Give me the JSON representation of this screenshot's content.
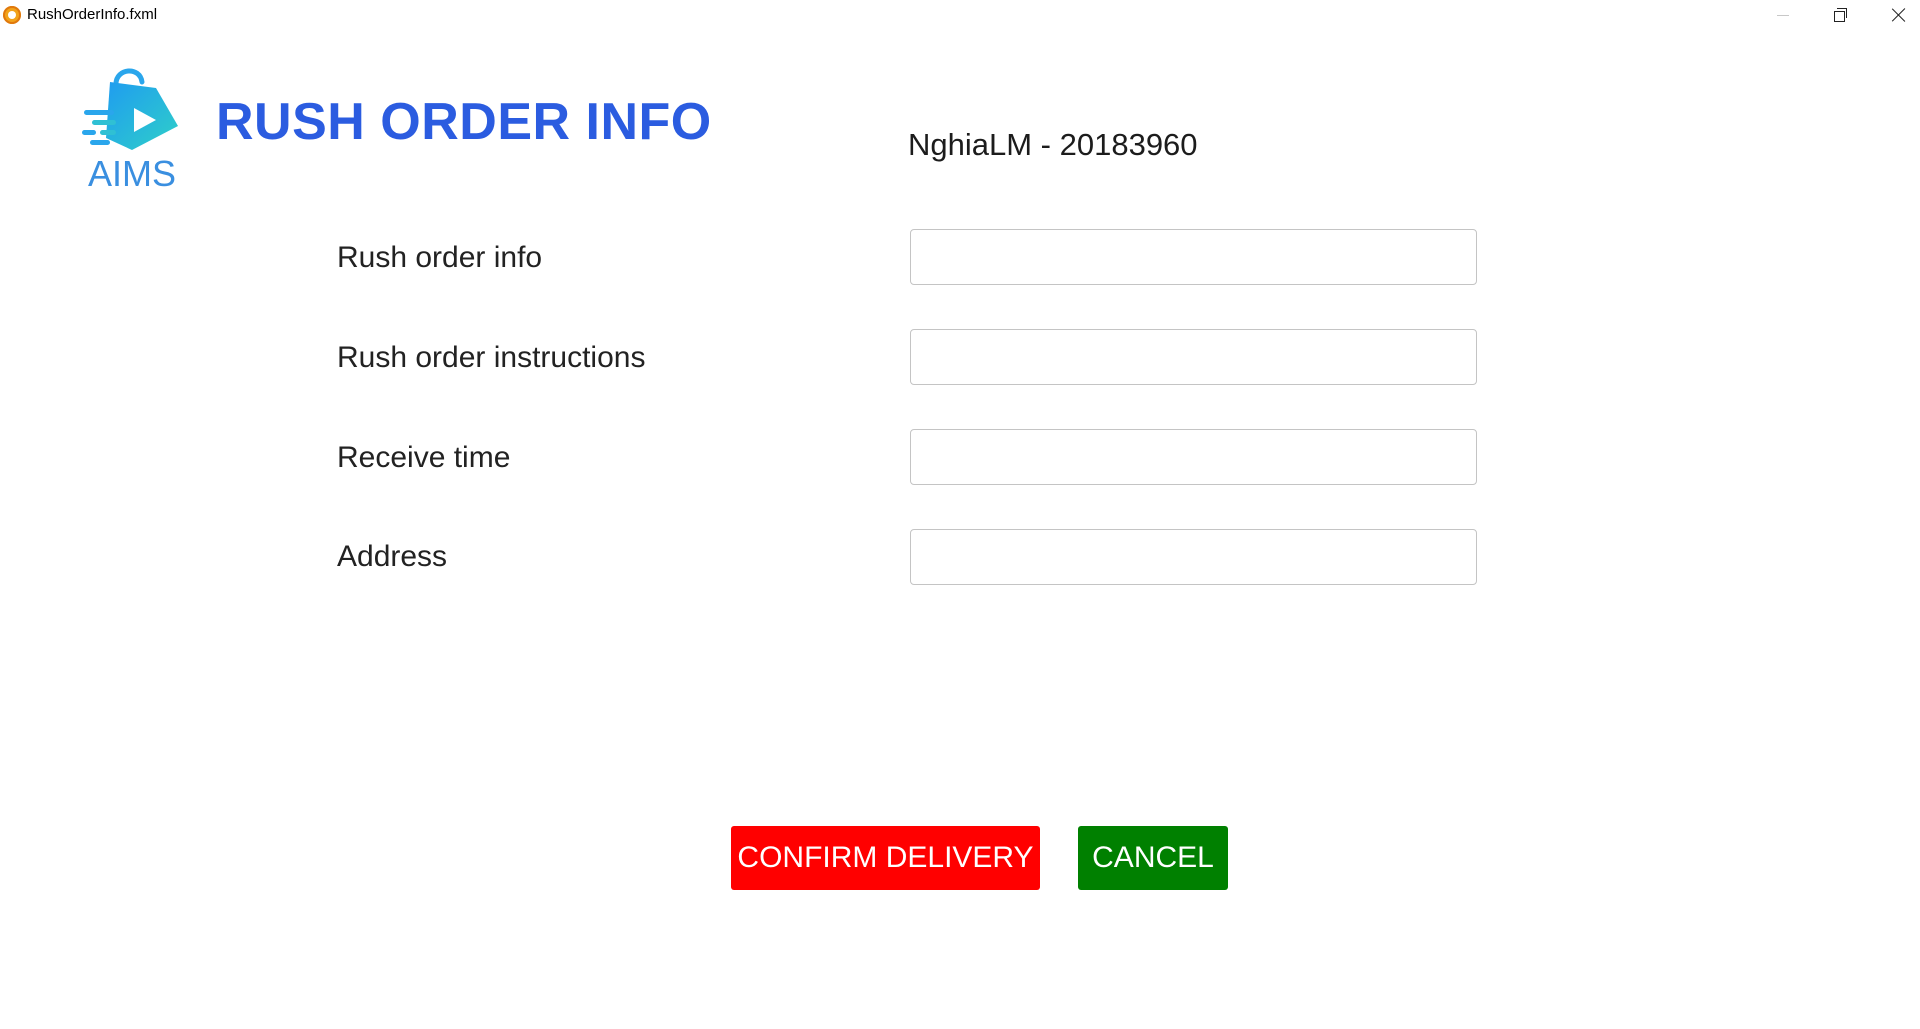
{
  "window": {
    "title": "RushOrderInfo.fxml"
  },
  "header": {
    "logo_text": "AIMS",
    "title": "RUSH ORDER INFO",
    "student_info": "NghiaLM - 20183960"
  },
  "form": {
    "fields": [
      {
        "label": "Rush order info",
        "value": "",
        "placeholder": ""
      },
      {
        "label": "Rush order instructions",
        "value": "",
        "placeholder": ""
      },
      {
        "label": "Receive time",
        "value": "",
        "placeholder": ""
      },
      {
        "label": "Address",
        "value": "",
        "placeholder": ""
      }
    ]
  },
  "actions": {
    "confirm_label": "CONFIRM DELIVERY",
    "cancel_label": "CANCEL"
  },
  "colors": {
    "title_blue": "#2b5ce0",
    "confirm_red": "#ff0000",
    "cancel_green": "#008000"
  },
  "icons": {
    "app": "fx-app-icon",
    "logo": "shopping-bag-play-icon",
    "minimize": "minimize-icon",
    "restore": "restore-icon",
    "close": "close-icon"
  }
}
